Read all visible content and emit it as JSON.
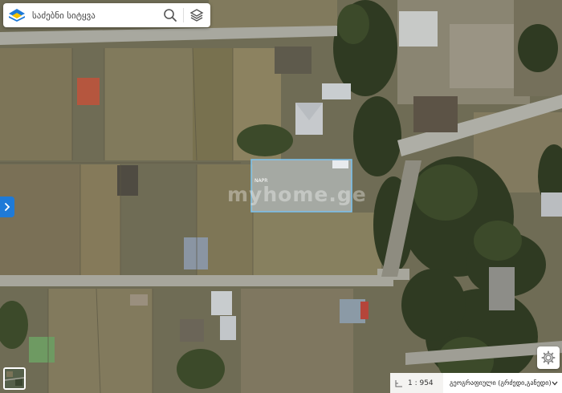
{
  "search": {
    "placeholder": "საძებნი სიტყვა"
  },
  "map": {
    "watermark": "myhome.ge",
    "parcel_label": "NAPR",
    "parcel_outline_color": "#7cc3f0"
  },
  "controls": {
    "search_icon": "search-icon",
    "layers_icon": "layers-icon",
    "side_toggle_icon": "chevron-right-icon",
    "settings_icon": "gear-icon"
  },
  "bottom_bar": {
    "scale_text": "1 : 954",
    "basemap_selected": "გეოგრაფიული (გრძედი,განედი)"
  },
  "colors": {
    "accent": "#1e7ad8",
    "logo_blue": "#1e7ad8",
    "logo_yellow": "#f5c400"
  }
}
